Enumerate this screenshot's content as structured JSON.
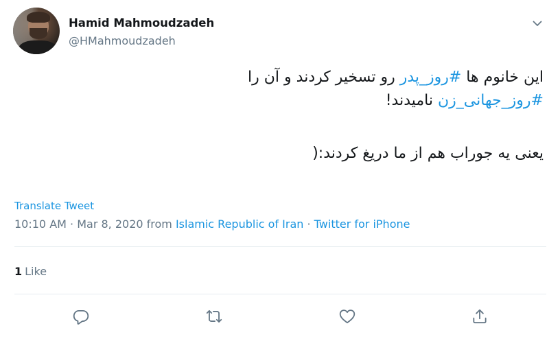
{
  "author": {
    "name": "Hamid Mahmoudzadeh",
    "handle": "@HMahmoudzadeh"
  },
  "tweet": {
    "line1_start": "این خانوم ها ",
    "line1_hashtag": "#روز_پدر",
    "line1_end": " رو تسخیر کردند و آن را",
    "line2_hashtag": "#روز_جهانی_زن",
    "line2_end": " نامیدند!",
    "line3": "یعنی یه جوراب هم از ما دریغ کردند:("
  },
  "translate_label": "Translate Tweet",
  "meta": {
    "timestamp": "10:10 AM · Mar 8, 2020",
    "from_word": " from ",
    "location": "Islamic Republic of Iran",
    "separator": " · ",
    "source": "Twitter for iPhone"
  },
  "stats": {
    "like_count": "1",
    "like_label": "Like"
  },
  "colors": {
    "link": "#1b95e0",
    "secondary_text": "#657786",
    "icon": "#657786",
    "divider": "#e6ecf0"
  },
  "icons": {
    "more": "chevron-down-icon",
    "reply": "reply-icon",
    "retweet": "retweet-icon",
    "like": "heart-icon",
    "share": "share-icon"
  }
}
